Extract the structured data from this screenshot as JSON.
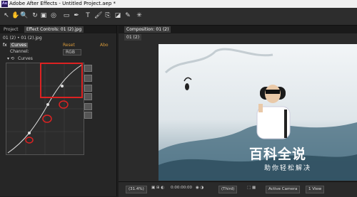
{
  "window": {
    "title": "Adobe After Effects - Untitled Project.aep *",
    "app_logo": "Ae"
  },
  "toolbar": {
    "tools": [
      "selection-tool",
      "hand-tool",
      "zoom-tool",
      "rotate-tool",
      "camera-tool",
      "pan-behind-tool",
      "rectangle-tool",
      "pen-tool",
      "text-tool",
      "brush-tool",
      "clone-stamp-tool",
      "eraser-tool",
      "roto-brush-tool",
      "puppet-pin-tool"
    ],
    "glyphs": [
      "↖",
      "✋",
      "🔍",
      "↻",
      "▣",
      "◎",
      "▭",
      "✒",
      "T",
      "🖌",
      "⎘",
      "◪",
      "✎",
      "✳"
    ]
  },
  "left": {
    "tabs": [
      "Project",
      "Effect Controls: 01 (2).jpg"
    ],
    "crumb": "01 (2) • 01 (2).jpg",
    "effect_name": "Curves",
    "reset": "Reset",
    "about": "Abo",
    "channel_label": "Channel:",
    "channel_value": "RGB",
    "curves_label": "Curves"
  },
  "comp": {
    "tab": "Composition: 01 (2)",
    "sub_tab": "01 (2)"
  },
  "bottombar": {
    "zoom": "(31.4%)",
    "timecode": "0:00:00:00",
    "resolution": "(Third)",
    "camera": "Active Camera",
    "view": "1 View"
  },
  "watermark": {
    "title": "百科全说",
    "subtitle": "助你轻松解决"
  },
  "colors": {
    "accent_red": "#d22222",
    "panel_bg": "#262626",
    "link_orange": "#d89a3a"
  }
}
